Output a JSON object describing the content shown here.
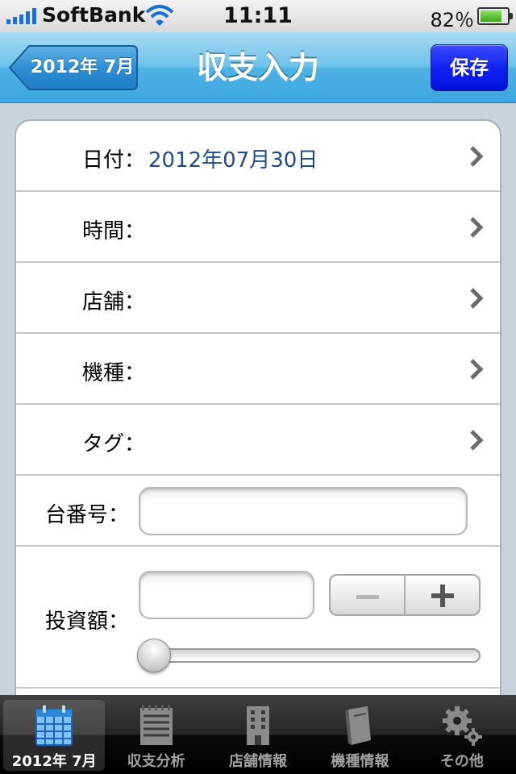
{
  "status_bar": {
    "carrier": "SoftBank",
    "time": "11:11",
    "battery": "82％",
    "battery_level": 0.82
  },
  "nav": {
    "back_label": "2012年 7月",
    "title": "収支入力",
    "save_label": "保存"
  },
  "form": {
    "rows": [
      {
        "label": "日付：",
        "value": "2012年07月30日"
      },
      {
        "label": "時間：",
        "value": ""
      },
      {
        "label": "店舗：",
        "value": ""
      },
      {
        "label": "機種：",
        "value": ""
      },
      {
        "label": "タグ：",
        "value": ""
      }
    ],
    "machine_number": {
      "label": "台番号：",
      "value": ""
    },
    "investment": {
      "label": "投資額：",
      "value": "",
      "slider_level": 0
    }
  },
  "tab_bar": {
    "tabs": [
      {
        "label": "2012年 7月",
        "icon": "calendar-icon",
        "selected": true
      },
      {
        "label": "収支分析",
        "icon": "notepad-icon",
        "selected": false
      },
      {
        "label": "店舗情報",
        "icon": "building-icon",
        "selected": false
      },
      {
        "label": "機種情報",
        "icon": "book-icon",
        "selected": false
      },
      {
        "label": "その他",
        "icon": "gears-icon",
        "selected": false
      }
    ]
  },
  "colors": {
    "nav_bar": "#4fb2e4",
    "save_button": "#1023f0",
    "date_value": "#214b86"
  }
}
